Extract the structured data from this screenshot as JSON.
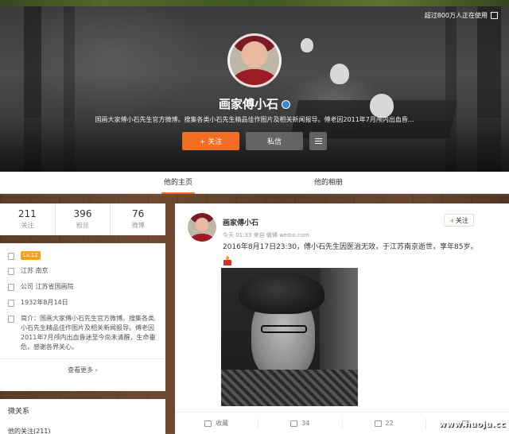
{
  "cover": {
    "usage_notice": "超过800万人正在使用",
    "name": "画家傅小石",
    "description": "国画大家傅小石先生官方微博。搜集各类小石先生精品佳作图片及相关新闻报导。傅老因2011年7月颅内出血昏..."
  },
  "actions": {
    "follow_label": "+ 关注",
    "message_label": "私信"
  },
  "tabs": [
    {
      "label": "他的主页",
      "active": true
    },
    {
      "label": "他的相册",
      "active": false
    }
  ],
  "stats": [
    {
      "num": "211",
      "label": "关注"
    },
    {
      "num": "396",
      "label": "粉丝"
    },
    {
      "num": "76",
      "label": "微博"
    }
  ],
  "info": {
    "level": "Lv.12",
    "location": "江苏 南京",
    "company": "公司 江苏省国画院",
    "birthday": "1932年8月14日",
    "bio": "简介：国画大家傅小石先生官方微博。搜集各类小石先生精品佳作图片及相关新闻报导。傅老因2011年7月颅内出血昏迷至今尚未清醒，生命垂危，感谢各界关心。",
    "more": "查看更多 ›"
  },
  "relations": {
    "title": "微关系",
    "sub": "他的关注(211)"
  },
  "post": {
    "author": "画家傅小石",
    "meta": "今天 01:33 来自 微博 weibo.com",
    "follow_label": "关注",
    "text": "2016年8月17日23:30，傅小石先生因医治无效，于江苏南京逝世，享年85岁。",
    "actions": [
      {
        "label": "收藏"
      },
      {
        "label": "34"
      },
      {
        "label": "22"
      },
      {
        "label": ""
      }
    ]
  },
  "watermark": "www.huoju.cc",
  "colors": {
    "accent": "#f26c22",
    "verified": "#3a86d6",
    "level_badge": "#f7a01a"
  }
}
